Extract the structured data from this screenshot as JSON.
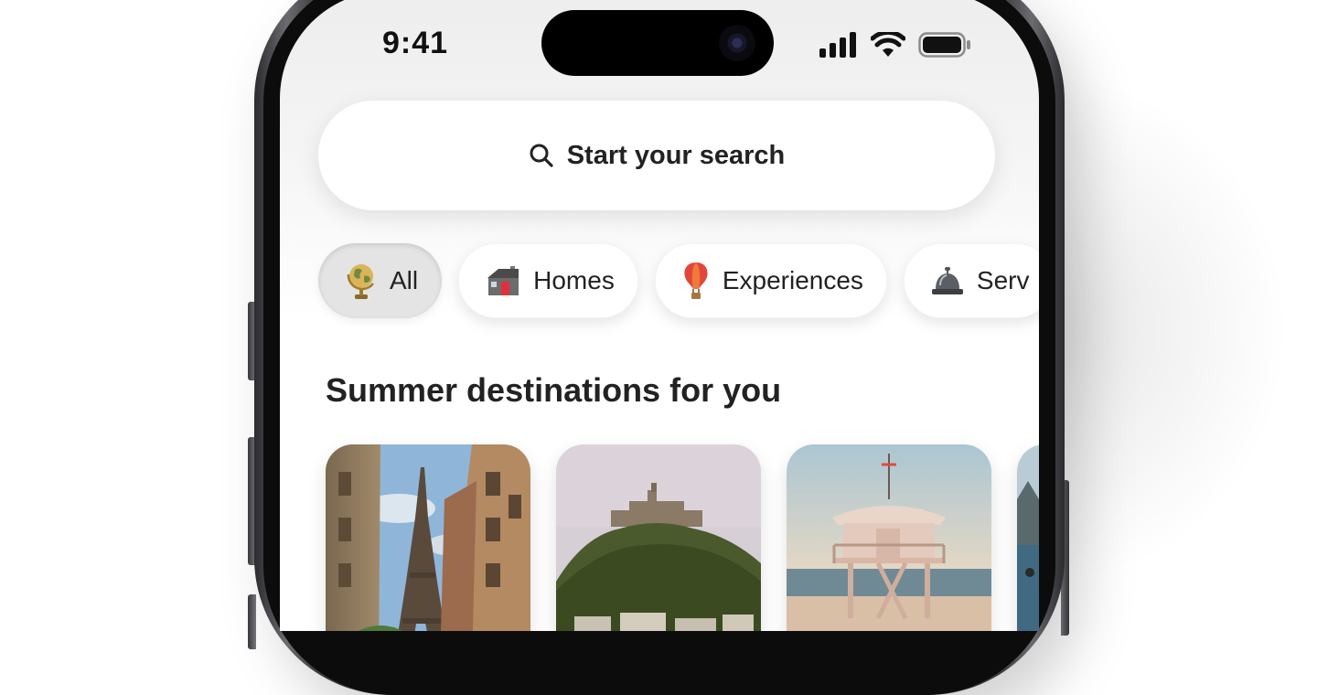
{
  "status_bar": {
    "time": "9:41",
    "icons": [
      "cellular-signal-icon",
      "wifi-icon",
      "battery-icon"
    ]
  },
  "search": {
    "icon": "search-icon",
    "label": "Start your search"
  },
  "categories": [
    {
      "label": "All",
      "icon": "globe-icon",
      "selected": true
    },
    {
      "label": "Homes",
      "icon": "house-icon",
      "selected": false
    },
    {
      "label": "Experiences",
      "icon": "hot-air-balloon-icon",
      "selected": false
    },
    {
      "label": "Serv",
      "icon": "service-bell-icon",
      "selected": false
    }
  ],
  "section": {
    "title": "Summer destinations for you"
  },
  "destinations": [
    {
      "image": "eiffel-tower-street-photo"
    },
    {
      "image": "island-castle-photo"
    },
    {
      "image": "lifeguard-tower-beach-photo"
    },
    {
      "image": "coastal-mountain-photo"
    }
  ],
  "colors": {
    "text": "#222222",
    "screen_bg": "#f5f5f5",
    "selected_chip": "#e4e4e4"
  }
}
